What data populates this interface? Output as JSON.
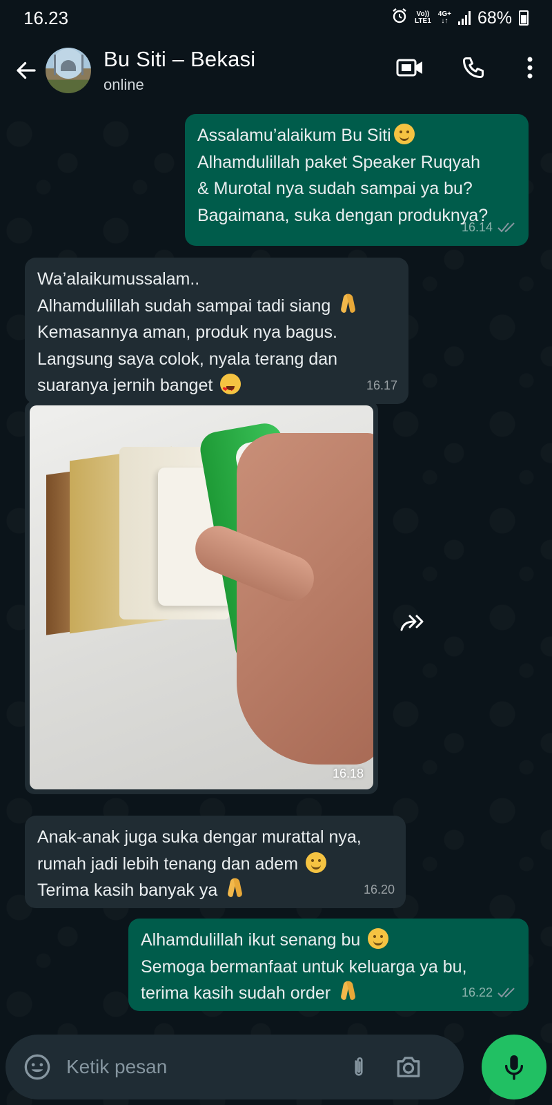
{
  "status_bar": {
    "time": "16.23",
    "volte_top": "Vo))",
    "volte_bottom": "LTE1",
    "network": "4G+",
    "battery": "68%"
  },
  "header": {
    "contact_name": "Bu Siti – Bekasi",
    "contact_status": "online"
  },
  "messages": [
    {
      "direction": "outgoing",
      "lines": [
        "Assalamu’alaikum Bu Siti",
        "Alhamdulillah paket Speaker Ruqyah",
        "& Murotal nya sudah sampai ya bu?",
        "Bagaimana, suka dengan produknya?"
      ],
      "time": "16.14",
      "ticks": "read"
    },
    {
      "direction": "incoming",
      "lines": [
        "Wa’alaikumussalam..",
        "Alhamdulillah sudah sampai tadi siang",
        "Kemasannya aman, produk nya bagus.",
        "Langsung saya colok, nyala terang dan",
        "suaranya jernih banget"
      ],
      "time": "16.17"
    },
    {
      "direction": "incoming",
      "type": "image",
      "time": "16.18"
    },
    {
      "direction": "incoming",
      "lines": [
        "Anak-anak juga suka dengar murattal nya,",
        "rumah jadi lebih tenang dan adem",
        "Terima kasih banyak ya"
      ],
      "time": "16.20"
    },
    {
      "direction": "outgoing",
      "lines": [
        "Alhamdulillah ikut senang bu",
        "Semoga bermanfaat untuk keluarga ya bu,",
        "terima kasih sudah order"
      ],
      "time": "16.22",
      "ticks": "read"
    }
  ],
  "composer": {
    "placeholder": "Ketik pesan"
  },
  "icons": {
    "back": "arrow-left-icon",
    "video": "video-call-icon",
    "call": "phone-icon",
    "menu": "more-vertical-icon",
    "emoji": "emoji-icon",
    "attach": "paperclip-icon",
    "camera": "camera-icon",
    "mic": "mic-icon",
    "forward": "forward-icon"
  },
  "colors": {
    "background": "#0b141a",
    "outgoing_bubble": "#005c4b",
    "incoming_bubble": "#202c33",
    "mic_button": "#21c063",
    "read_ticks": "#8696a0"
  }
}
